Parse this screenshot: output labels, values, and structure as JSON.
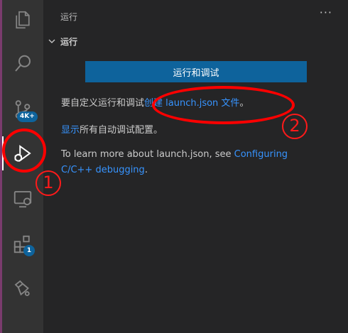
{
  "sidebar": {
    "title": "运行",
    "more_actions": "···",
    "section": {
      "title": "运行"
    },
    "run_button_label": "运行和调试",
    "line1": {
      "prefix": "要自定义运行和调试",
      "link": "创建 launch.json 文件",
      "suffix": "。"
    },
    "line2": {
      "link": "显示",
      "suffix": "所有自动调试配置。"
    },
    "line3": {
      "prefix": "To learn more about launch.json, see ",
      "link": "Configuring C/C++ debugging",
      "suffix": "."
    }
  },
  "activity_bar": {
    "items": [
      {
        "name": "explorer",
        "icon": "files-icon"
      },
      {
        "name": "search",
        "icon": "search-icon"
      },
      {
        "name": "source-control",
        "icon": "source-control-icon",
        "badge": "4K+"
      },
      {
        "name": "run-and-debug",
        "icon": "run-debug-icon",
        "active": true
      },
      {
        "name": "remote-explorer",
        "icon": "remote-explorer-icon"
      },
      {
        "name": "extensions",
        "icon": "extensions-icon",
        "badge": "1"
      },
      {
        "name": "cmake",
        "icon": "cmake-icon"
      }
    ]
  },
  "annotations": {
    "marker1": "1",
    "marker2": "2"
  },
  "colors": {
    "activity_bg": "#333333",
    "sidebar_bg": "#252526",
    "button_bg": "#0e639c",
    "link": "#3794ff",
    "annotation": "#ff0000"
  }
}
